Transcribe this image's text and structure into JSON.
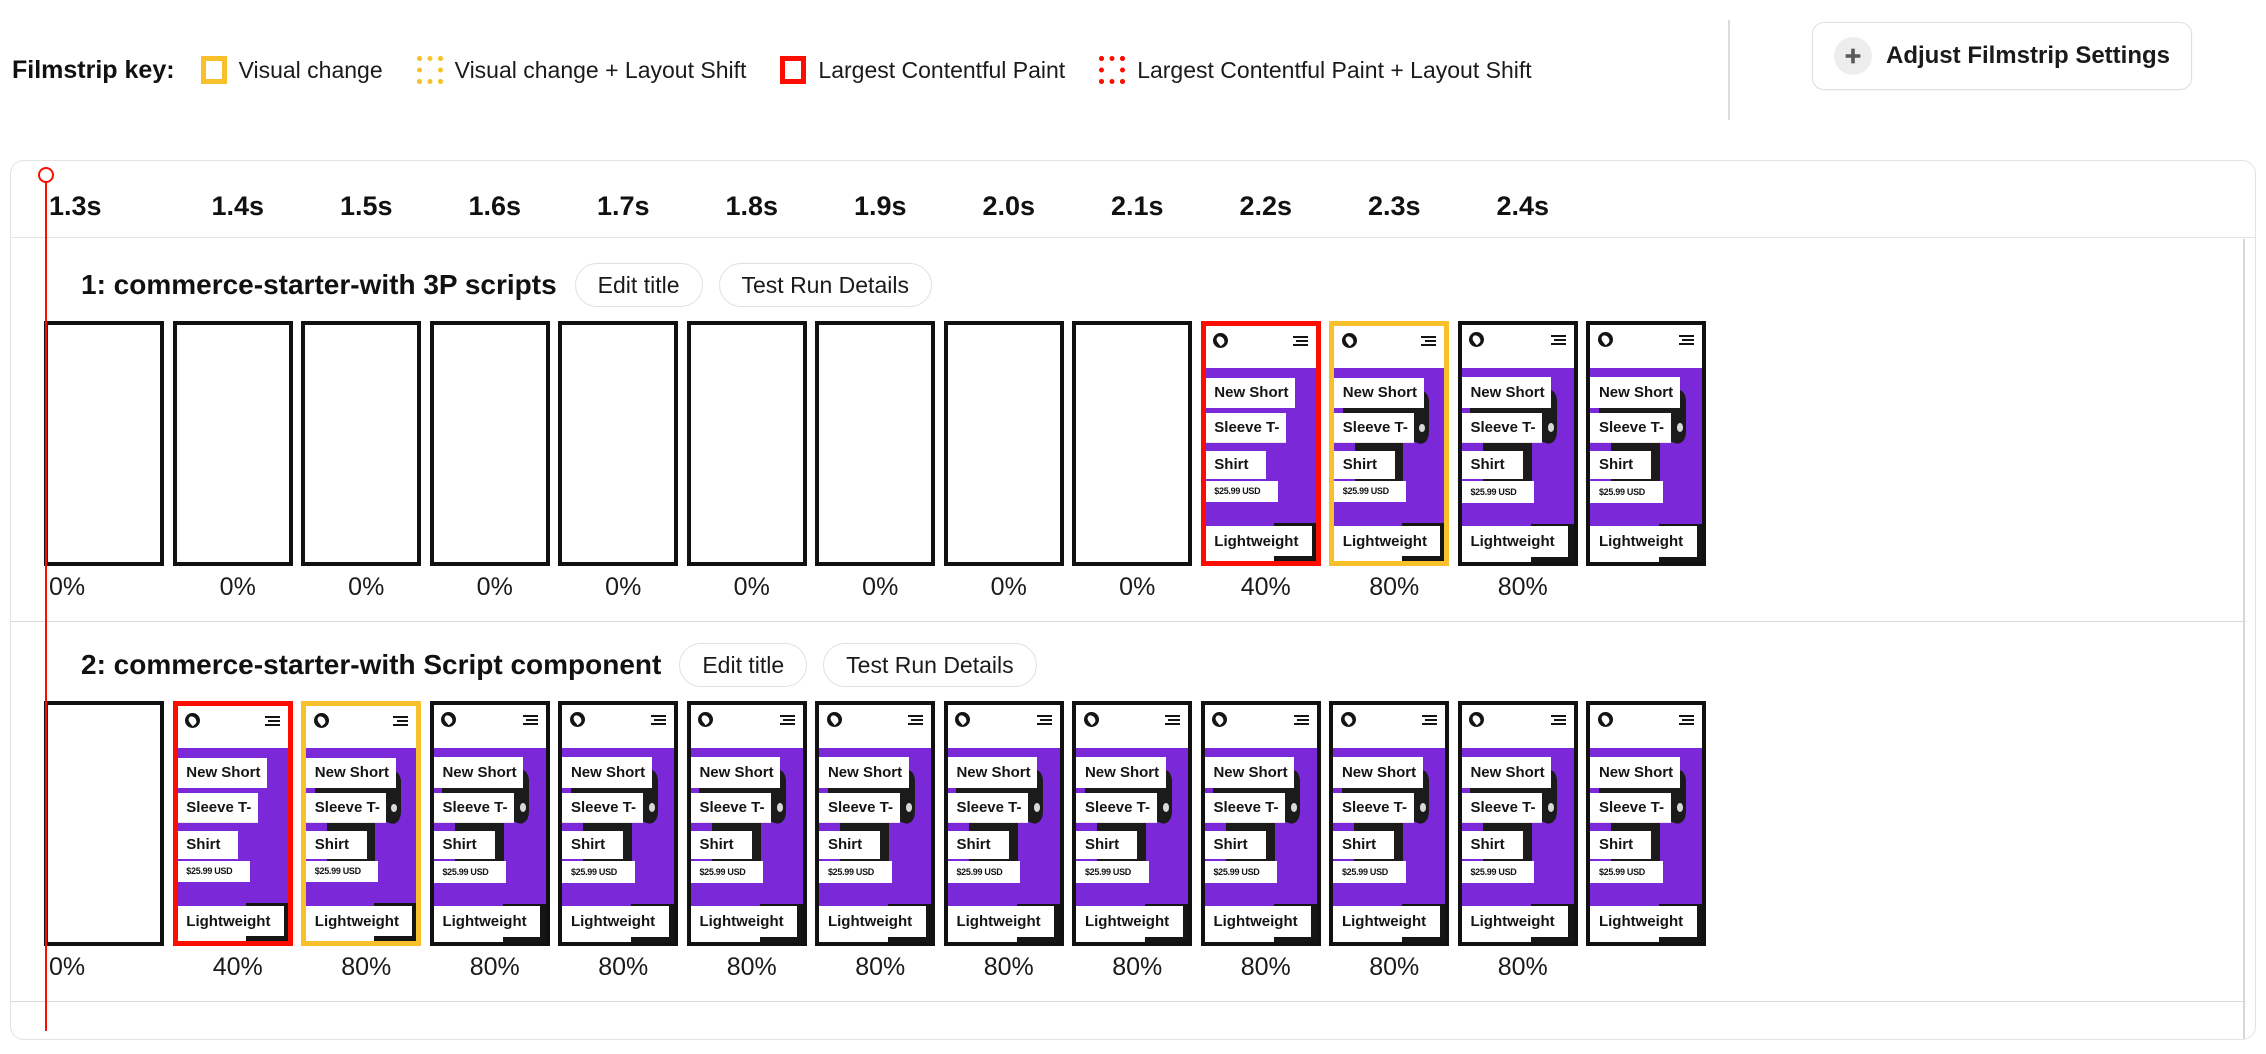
{
  "legend": {
    "title": "Filmstrip key:",
    "items": [
      {
        "label": "Visual change",
        "style": "solid",
        "color": "#F8C12C",
        "icon": "solid-square-icon"
      },
      {
        "label": "Visual change + Layout Shift",
        "style": "dotted",
        "color": "#F8C12C",
        "icon": "dotted-square-icon"
      },
      {
        "label": "Largest Contentful Paint",
        "style": "solid",
        "color": "#FC0D00",
        "icon": "solid-square-icon"
      },
      {
        "label": "Largest Contentful Paint + Layout Shift",
        "style": "dotted",
        "color": "#FC0D00",
        "icon": "dotted-square-icon"
      }
    ]
  },
  "settings_button": {
    "label": "Adjust Filmstrip Settings",
    "icon": "plus-icon"
  },
  "timeline": {
    "ticks": [
      "1.3s",
      "1.4s",
      "1.5s",
      "1.6s",
      "1.7s",
      "1.8s",
      "1.9s",
      "2.0s",
      "2.1s",
      "2.2s",
      "2.3s",
      "2.4s"
    ],
    "playhead_color": "#FC0D00"
  },
  "colors": {
    "visual_change": "#F8C12C",
    "lcp": "#FC0D00",
    "neutral_frame": "#111111",
    "hero_purple": "#7B28D8",
    "shirt_black": "#1b1b1b"
  },
  "thumbnail_content": {
    "line1": "New Short",
    "line2": "Sleeve T-",
    "line3": "Shirt",
    "price": "$25.99 USD",
    "line4": "Lightweight",
    "logo_icon": "brand-logo-icon",
    "menu_icon": "hamburger-menu-icon"
  },
  "runs": [
    {
      "title": "1: commerce-starter-with 3P scripts",
      "edit_label": "Edit title",
      "details_label": "Test Run Details",
      "frames": [
        {
          "pct": "0%",
          "border": "black",
          "content": false
        },
        {
          "pct": "0%",
          "border": "black",
          "content": false
        },
        {
          "pct": "0%",
          "border": "black",
          "content": false
        },
        {
          "pct": "0%",
          "border": "black",
          "content": false
        },
        {
          "pct": "0%",
          "border": "black",
          "content": false
        },
        {
          "pct": "0%",
          "border": "black",
          "content": false
        },
        {
          "pct": "0%",
          "border": "black",
          "content": false
        },
        {
          "pct": "0%",
          "border": "black",
          "content": false
        },
        {
          "pct": "0%",
          "border": "black",
          "content": false
        },
        {
          "pct": "40%",
          "border": "red",
          "content": true,
          "shirt": false
        },
        {
          "pct": "80%",
          "border": "amber",
          "content": true,
          "shirt": true
        },
        {
          "pct": "80%",
          "border": "black",
          "content": true,
          "shirt": true
        },
        {
          "pct": "",
          "border": "black",
          "content": true,
          "shirt": true
        }
      ]
    },
    {
      "title": "2: commerce-starter-with Script component",
      "edit_label": "Edit title",
      "details_label": "Test Run Details",
      "frames": [
        {
          "pct": "0%",
          "border": "black",
          "content": false
        },
        {
          "pct": "40%",
          "border": "red",
          "content": true,
          "shirt": false
        },
        {
          "pct": "80%",
          "border": "amber",
          "content": true,
          "shirt": true
        },
        {
          "pct": "80%",
          "border": "black",
          "content": true,
          "shirt": true
        },
        {
          "pct": "80%",
          "border": "black",
          "content": true,
          "shirt": true
        },
        {
          "pct": "80%",
          "border": "black",
          "content": true,
          "shirt": true
        },
        {
          "pct": "80%",
          "border": "black",
          "content": true,
          "shirt": true
        },
        {
          "pct": "80%",
          "border": "black",
          "content": true,
          "shirt": true
        },
        {
          "pct": "80%",
          "border": "black",
          "content": true,
          "shirt": true
        },
        {
          "pct": "80%",
          "border": "black",
          "content": true,
          "shirt": true
        },
        {
          "pct": "80%",
          "border": "black",
          "content": true,
          "shirt": true
        },
        {
          "pct": "80%",
          "border": "black",
          "content": true,
          "shirt": true
        },
        {
          "pct": "",
          "border": "black",
          "content": true,
          "shirt": true
        }
      ]
    }
  ]
}
